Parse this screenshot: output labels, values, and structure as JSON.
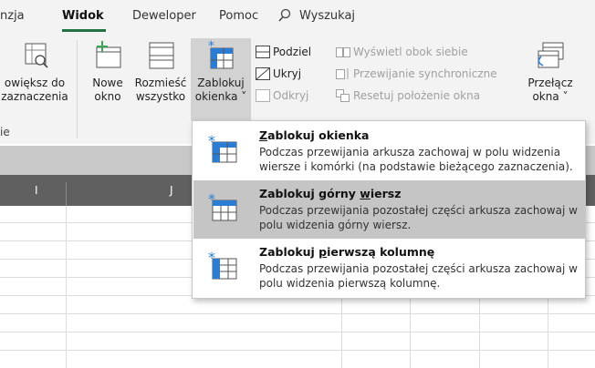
{
  "menu": {
    "tabs": [
      "nzja",
      "Widok",
      "Deweloper",
      "Pomoc"
    ],
    "search_label": "Wyszukaj"
  },
  "ribbon": {
    "zoom_selection": {
      "line1": "owiększ do",
      "line2": "zaznaczenia"
    },
    "new_window": {
      "line1": "Nowe",
      "line2": "okno"
    },
    "arrange_all": {
      "line1": "Rozmieść",
      "line2": "wszystko"
    },
    "freeze_panes": {
      "line1": "Zablokuj",
      "line2": "okienka ˅"
    },
    "split": "Podziel",
    "hide": "Ukryj",
    "unhide": "Odkryj",
    "view_side_by_side": "Wyświetl obok siebie",
    "sync_scroll": "Przewijanie synchroniczne",
    "reset_position": "Resetuj położenie okna",
    "switch_windows": {
      "line1": "Przełącz",
      "line2": "okna ˅"
    },
    "group_label_fragment": "ie"
  },
  "columns": [
    "I",
    "J"
  ],
  "dropdown": {
    "items": [
      {
        "title_pre": "",
        "title_ul": "Z",
        "title_post": "ablokuj okienka",
        "desc": "Podczas przewijania arkusza zachowaj w polu widzenia wiersze i komórki (na podstawie bieżącego zaznaczenia)."
      },
      {
        "title_pre": "Zablokuj górny ",
        "title_ul": "w",
        "title_post": "iersz",
        "desc": "Podczas przewijania pozostałej części arkusza zachowaj w polu widzenia górny wiersz."
      },
      {
        "title_pre": "Zablokuj ",
        "title_ul": "p",
        "title_post": "ierwszą kolumnę",
        "desc": "Podczas przewijania pozostałej części arkusza zachowaj w polu widzenia pierwszą kolumnę."
      }
    ]
  },
  "colors": {
    "accent": "#217346",
    "icon_blue": "#2b7cd3",
    "ribbon_bg": "#f3f3f3",
    "hover_bg": "#c5c5c5",
    "col_header_bg": "#606060"
  }
}
